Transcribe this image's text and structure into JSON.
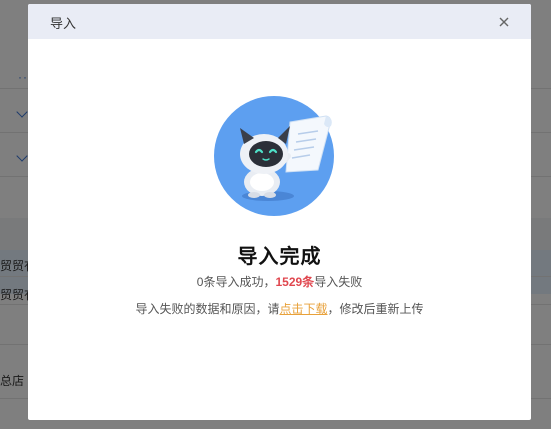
{
  "background": {
    "row_texts": [
      "贸贸有",
      "贸贸有",
      "总店"
    ]
  },
  "dialog": {
    "title": "导入",
    "close_label": "×",
    "result_title": "导入完成",
    "summary": {
      "success_text": "0条导入成功，",
      "fail_count": "1529条",
      "fail_text": "导入失败"
    },
    "hint": {
      "prefix": "导入失败的数据和原因，请",
      "link": "点击下载",
      "suffix": "，修改后重新上传"
    }
  },
  "colors": {
    "overlay": "#000000",
    "header_bg": "#e9ecf5",
    "fail_red": "#e0474f",
    "link_orange": "#e8a13a",
    "illustration_blue": "#5d9ff0"
  },
  "icons": {
    "close": "close-icon",
    "illustration": "robot-mascot-illustration"
  }
}
